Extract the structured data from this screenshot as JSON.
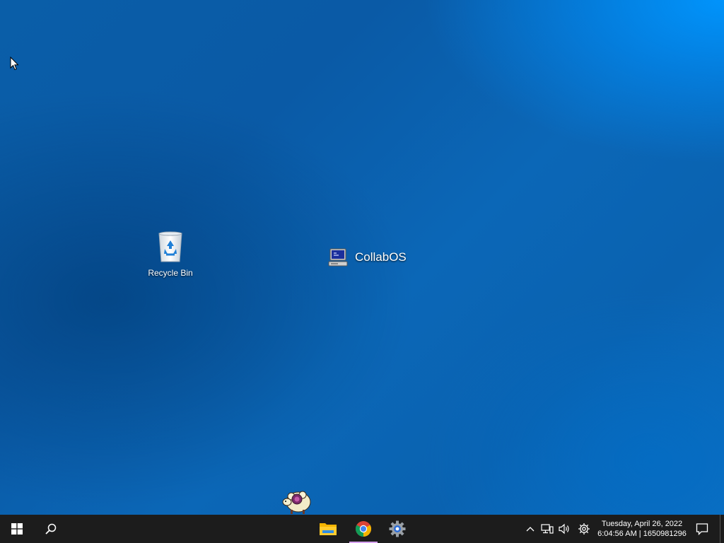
{
  "desktop": {
    "icons": [
      {
        "label": "Recycle Bin",
        "icon": "recycle-bin-icon"
      },
      {
        "label": "CollabOS",
        "icon": "computer-icon"
      }
    ],
    "mascot": "sheep-icon",
    "background_accent": "#0a5ea8"
  },
  "taskbar": {
    "start": "windows-logo-icon",
    "search": "search-icon",
    "pinned_apps": [
      {
        "icon": "file-explorer-icon"
      },
      {
        "icon": "chrome-icon",
        "active": true
      },
      {
        "icon": "settings-icon"
      }
    ],
    "tray": {
      "icons": [
        "chevron-up-icon",
        "network-icon",
        "volume-icon",
        "gear-icon"
      ]
    },
    "clock": {
      "date": "Tuesday, April 26, 2022",
      "time": "6:04:56 AM | 1650981296"
    },
    "notifications": "notification-icon"
  }
}
